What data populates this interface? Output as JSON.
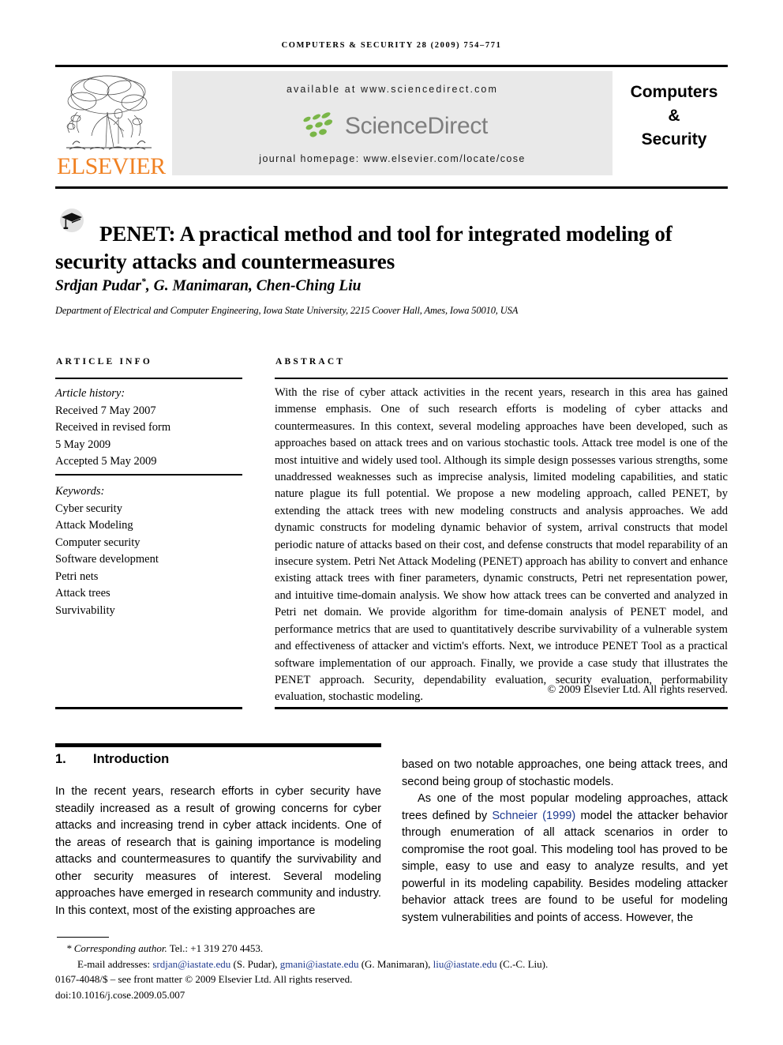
{
  "running_head": "Computers & Security 28 (2009) 754–771",
  "masthead": {
    "publisher_logo_text": "ELSEVIER",
    "available_at": "available at www.sciencedirect.com",
    "sciencedirect_wordmark": "ScienceDirect",
    "journal_homepage": "journal homepage: www.elsevier.com/locate/cose",
    "journal_title_line1": "Computers",
    "journal_title_line2": "&",
    "journal_title_line3": "Security",
    "banner_bg": "#e9e9e9",
    "elsevier_orange": "#F08122",
    "sciencedirect_green": "#7ab648",
    "sciencedirect_gray": "#7e7e7e"
  },
  "article": {
    "title": "PENET: A practical method and tool for integrated modeling of security attacks and countermeasures",
    "authors": "Srdjan Pudar",
    "authors_marker": "*",
    "authors_rest": ", G. Manimaran, Chen-Ching Liu",
    "affiliation": "Department of Electrical and Computer Engineering, Iowa State University, 2215 Coover Hall, Ames, Iowa 50010, USA"
  },
  "article_info": {
    "heading": "Article info",
    "history_heading": "Article history:",
    "history": [
      "Received 7 May 2007",
      "Received in revised form",
      "5 May 2009",
      "Accepted 5 May 2009"
    ],
    "keywords_heading": "Keywords:",
    "keywords": [
      "Cyber security",
      "Attack Modeling",
      "Computer security",
      "Software development",
      "Petri nets",
      "Attack trees",
      "Survivability"
    ]
  },
  "abstract": {
    "heading": "Abstract",
    "text": "With the rise of cyber attack activities in the recent years, research in this area has gained immense emphasis. One of such research efforts is modeling of cyber attacks and countermeasures. In this context, several modeling approaches have been developed, such as approaches based on attack trees and on various stochastic tools. Attack tree model is one of the most intuitive and widely used tool. Although its simple design possesses various strengths, some unaddressed weaknesses such as imprecise analysis, limited modeling capabilities, and static nature plague its full potential. We propose a new modeling approach, called PENET, by extending the attack trees with new modeling constructs and analysis approaches. We add dynamic constructs for modeling dynamic behavior of system, arrival constructs that model periodic nature of attacks based on their cost, and defense constructs that model reparability of an insecure system. Petri Net Attack Modeling (PENET) approach has ability to convert and enhance existing attack trees with finer parameters, dynamic constructs, Petri net representation power, and intuitive time-domain analysis. We show how attack trees can be converted and analyzed in Petri net domain. We provide algorithm for time-domain analysis of PENET model, and performance metrics that are used to quantitatively describe survivability of a vulnerable system and effectiveness of attacker and victim's efforts. Next, we introduce PENET Tool as a practical software implementation of our approach. Finally, we provide a case study that illustrates the PENET approach. Security, dependability evaluation, security evaluation, performability evaluation, stochastic modeling.",
    "copyright": "© 2009 Elsevier Ltd. All rights reserved."
  },
  "body": {
    "section_number": "1.",
    "section_title": "Introduction",
    "left_column": "In the recent years, research efforts in cyber security have steadily increased as a result of growing concerns for cyber attacks and increasing trend in cyber attack incidents. One of the areas of research that is gaining importance is modeling attacks and countermeasures to quantify the survivability and other security measures of interest. Several modeling approaches have emerged in research community and industry. In this context, most of the existing approaches are",
    "right_column_p1": "based on two notable approaches, one being attack trees, and second being group of stochastic models.",
    "right_column_p2_before": "As one of the most popular modeling approaches, attack trees defined by ",
    "right_column_citation": "Schneier (1999)",
    "right_column_p2_after": " model the attacker behavior through enumeration of all attack scenarios in order to compromise the root goal. This modeling tool has proved to be simple, easy to use and easy to analyze results, and yet powerful in its modeling capability. Besides modeling attacker behavior attack trees are found to be useful for modeling system vulnerabilities and points of access. However, the",
    "citation_color": "#1f3a8f"
  },
  "footnote": {
    "corresponding_label": "* Corresponding author.",
    "telephone": " Tel.: +1 319 270 4453.",
    "email_label": "E-mail addresses:",
    "emails": [
      {
        "address": "srdjan@iastate.edu",
        "person": "(S. Pudar)"
      },
      {
        "address": "gmani@iastate.edu",
        "person": "(G. Manimaran)"
      },
      {
        "address": "liu@iastate.edu",
        "person": "(C.-C. Liu)"
      }
    ],
    "issn_line": "0167-4048/$ – see front matter © 2009 Elsevier Ltd. All rights reserved.",
    "doi_line": "doi:10.1016/j.cose.2009.05.007"
  }
}
